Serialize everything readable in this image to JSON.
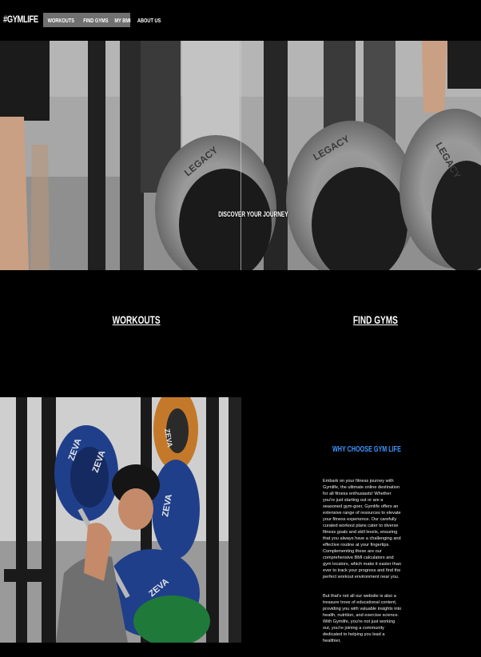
{
  "header": {
    "logo": "#GYMLIFE",
    "nav": [
      "WORKOUTS",
      "FIND GYMS",
      "MY BMI",
      "ABOUT US"
    ]
  },
  "hero": {
    "title": "DISCOVER YOUR JOURNEY",
    "plate_text": [
      "LEGACY",
      "LEGACY",
      "LEGACY"
    ]
  },
  "sections": {
    "workouts_label": "WORKOUTS",
    "find_gyms_label": "FIND GYMS"
  },
  "bottom_photo": {
    "plate_text": [
      "ZEVA",
      "ZEVA",
      "ZEVA",
      "ZEVA",
      "ZEVA"
    ]
  },
  "why": {
    "title": "WHY CHOOSE GYM LIFE",
    "paragraph_1": "Embark on your fitness journey with Gymlife, the ultimate online destination for all fitness enthusiasts! Whether you're just starting out or are a seasoned gym-goer, Gymlife offers an extensive range of resources to elevate your fitness experience. Our carefully curated workout plans cater to diverse fitness goals and skill levels, ensuring that you always have a challenging and effective routine at your fingertips. Complementing these are our comprehensive BMI calculators and gym locators, which make it easier than ever to track your progress and find the perfect workout environment near you.",
    "paragraph_2": "But that's not all our website is also a treasure trove of educational content, providing you with valuable insights into health, nutrition, and exercise science. With Gymlife, you're not just working out, you're joining a community dedicated to helping you lead a healthier,"
  },
  "colors": {
    "accent": "#3b96ff",
    "nav_bg": "#707070",
    "background": "#000000"
  }
}
